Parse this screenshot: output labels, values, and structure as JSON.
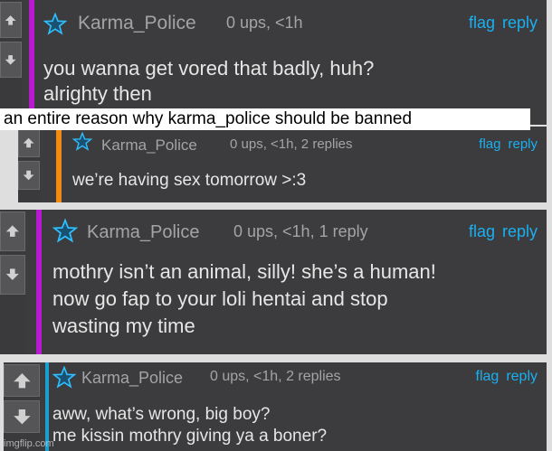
{
  "caption": "an entire reason why karma_police should be banned",
  "watermark": "imgflip.com",
  "actions": {
    "flag": "flag",
    "reply": "reply"
  },
  "comments": [
    {
      "username": "Karma_Police",
      "meta": "0 ups, <1h",
      "lines": [
        "you wanna get vored that badly, huh?",
        "alrighty then"
      ],
      "accent": "#b81ad0"
    },
    {
      "username": "Karma_Police",
      "meta": "0 ups, <1h, 2 replies",
      "lines": [
        "we’re having sex tomorrow >:3"
      ],
      "accent": "#f08a10"
    },
    {
      "username": "Karma_Police",
      "meta": "0 ups, <1h, 1 reply",
      "lines": [
        "mothry isn’t an animal, silly! she’s a human!",
        "now go fap to your loli hentai and stop",
        "wasting my time"
      ],
      "accent": "#b81ad0"
    },
    {
      "username": "Karma_Police",
      "meta": "0 ups, <1h, 2 replies",
      "lines": [
        "aww, what’s wrong, big boy?",
        "me kissin mothry giving ya a boner?"
      ],
      "accent": "#1aa0d0"
    }
  ],
  "icons": {
    "upvote": "arrow-up-icon",
    "downvote": "arrow-down-icon",
    "star": "star-outline-icon"
  }
}
